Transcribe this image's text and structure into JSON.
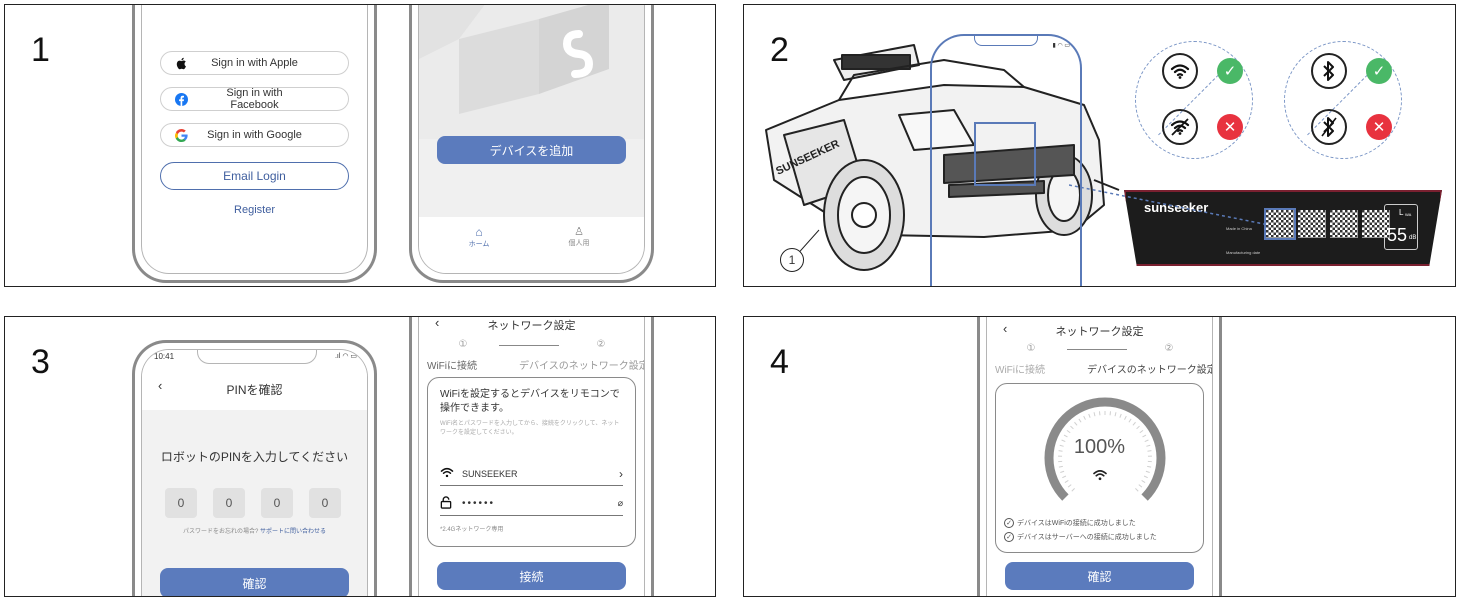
{
  "panels": [
    {
      "number": "1"
    },
    {
      "number": "2"
    },
    {
      "number": "3"
    },
    {
      "number": "4"
    }
  ],
  "colors": {
    "accent": "#5b7bbd",
    "link": "#3f5e9e",
    "ok": "#4ab867",
    "error": "#e8323f",
    "frame": "#222222"
  },
  "login": {
    "apple_label": "Sign in with Apple",
    "facebook_label": "Sign in with Facebook",
    "google_label": "Sign in with Google",
    "email_label": "Email Login",
    "register_label": "Register"
  },
  "home": {
    "add_device_label": "デバイスを追加",
    "tab_home": "ホーム",
    "tab_personal": "個人用"
  },
  "device": {
    "brand": "sunseeker",
    "callout_number": "1",
    "label_text": "Made in China",
    "label_code": "Manufacturing date",
    "noise_value": "55",
    "noise_unit": "dB",
    "noise_symbol": "L",
    "noise_sub": "WA",
    "icons": [
      "wifi-icon",
      "wifi-off-icon",
      "bluetooth-icon",
      "bluetooth-off-icon",
      "check-icon",
      "cross-icon"
    ]
  },
  "pin": {
    "time": "10:41",
    "title": "PINを確認",
    "prompt": "ロボットのPINを入力してください",
    "digits": [
      "0",
      "0",
      "0",
      "0"
    ],
    "help_text": "パスワードをお忘れの場合?",
    "help_link": "サポートに問い合わせる",
    "confirm_label": "確認"
  },
  "network": {
    "title": "ネットワーク設定",
    "step1_num": "①",
    "step2_num": "②",
    "step1_label": "WiFiに接続",
    "step2_label": "デバイスのネットワーク設定",
    "intro_title": "WiFiを設定するとデバイスをリモコンで操作できます。",
    "intro_text": "WiFi名とパスワードを入力してから、接続をクリックして、ネットワークを設定してください。",
    "ssid": "SUNSEEKER",
    "password_mask": "••••••",
    "note": "*2.4Gネットワーク専用",
    "connect_label": "接続"
  },
  "progress": {
    "title": "ネットワーク設定",
    "percent_text": "100%",
    "percent": 100,
    "msg1": "デバイスはWiFiの接続に成功しました",
    "msg2": "デバイスはサーバーへの接続に成功しました",
    "confirm_label": "確認"
  }
}
